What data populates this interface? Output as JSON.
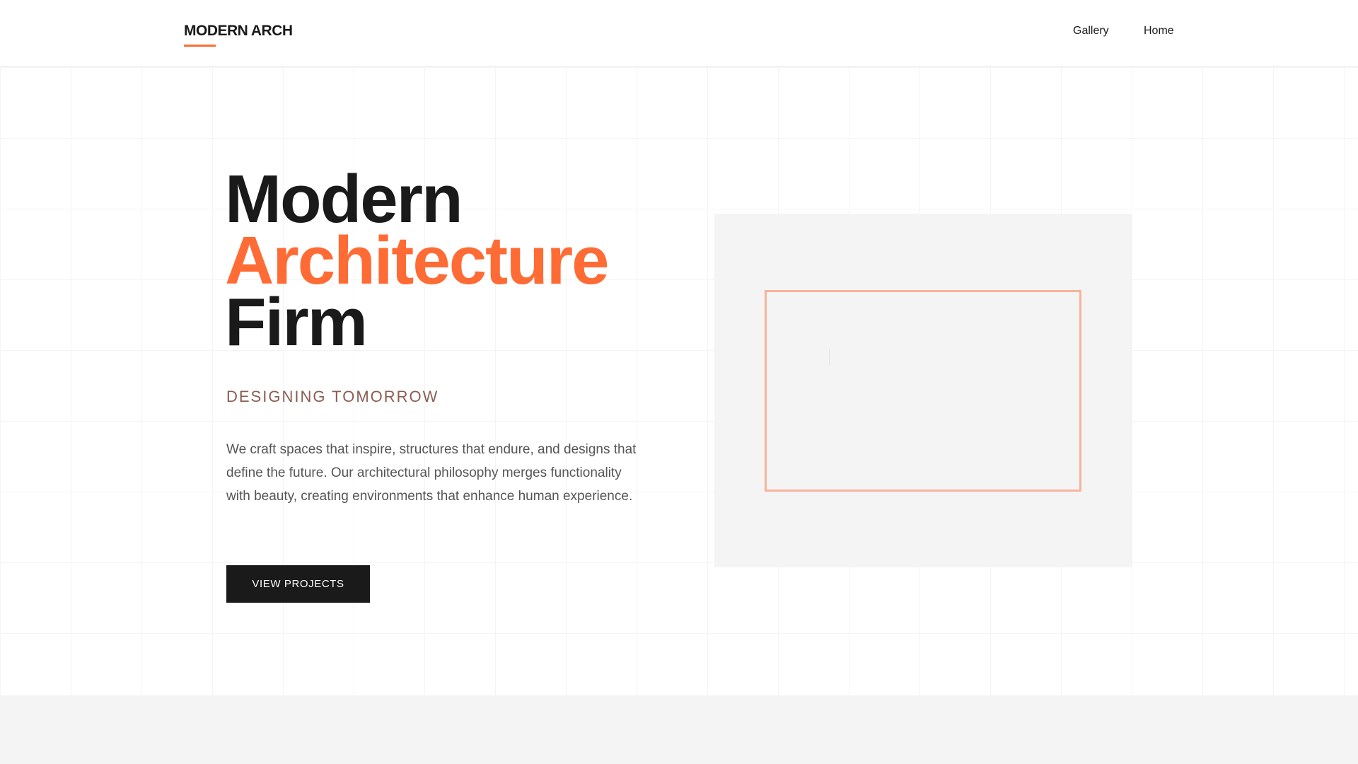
{
  "brand": {
    "logo_text": "MODERN ARCH",
    "accent_color": "#ff6b35"
  },
  "nav": {
    "links": [
      "Gallery",
      "Home"
    ]
  },
  "hero": {
    "title_line1": "Modern",
    "title_line2": "Architecture",
    "title_line3": "Firm",
    "subtitle": "DESIGNING TOMORROW",
    "description": "We craft spaces that inspire, structures that endure, and designs that define the future. Our architectural philosophy merges functionality with beauty, creating environments that enhance human experience.",
    "cta_label": "VIEW PROJECTS"
  },
  "colors": {
    "text_primary": "#1a1a1a",
    "subtitle": "#8a5e52",
    "panel_bg": "#f4f4f4",
    "frame_border": "#f8b39b"
  }
}
